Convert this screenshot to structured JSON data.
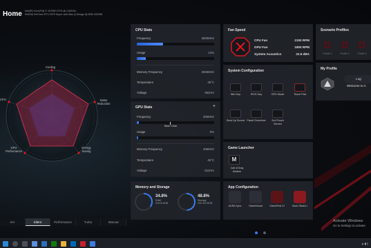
{
  "header": {
    "title": "Home",
    "cpu": "Intel(R) Core(TM) i7-10750H CPU @ 2.60GHz",
    "gpu": "NVIDIA GeForce RTX 2070 Super with Max-Q Design @ 8GB GDDR6"
  },
  "radar": {
    "labels": [
      "Cooling",
      "Noise Reduction",
      "Energy Saving",
      "GPU Performance",
      "CPU Performance"
    ],
    "label_short_cpu": "CPU"
  },
  "modes": [
    "ent",
    "Silent",
    "Performance",
    "Turbo",
    "Manual"
  ],
  "cpu_stats": {
    "title": "CPU Stats",
    "frequency_label": "Frequency",
    "frequency_value": "2500MHz",
    "frequency_pct": 0.34,
    "usage_label": "Usage",
    "usage_value": "12%",
    "usage_pct": 0.12,
    "memfreq_label": "Memory Frequency",
    "memfreq_value": "2926MHz",
    "temp_label": "Temperature",
    "temp_value": "45°C",
    "voltage_label": "Voltage",
    "voltage_value": "662mV"
  },
  "gpu_stats": {
    "title": "GPU Stats",
    "frequency_label": "Frequency",
    "frequency_value": "300MHz",
    "frequency_pct": 0.03,
    "base_clock_label": "Base Clock",
    "usage_label": "Usage",
    "usage_value": "0%",
    "usage_pct": 0.0,
    "memfreq_label": "Memory Frequency",
    "memfreq_value": "405MHz",
    "temp_label": "Temperature",
    "temp_value": "45°C",
    "voltage_label": "Voltage",
    "voltage_value": "612mV"
  },
  "fan_speed": {
    "title": "Fan Speed",
    "cpu_fan_label": "CPU Fan",
    "cpu_fan_value": "2100 RPM",
    "gpu_fan_label": "GPU Fan",
    "gpu_fan_value": "1800 RPM",
    "acoustics_label": "System Acoustics",
    "acoustics_value": "22.6 dBA"
  },
  "scenario_profiles": {
    "title": "Scenario Profiles",
    "profiles": [
      "Profile 1",
      "Profile 2",
      "Profile 3"
    ]
  },
  "my_profile": {
    "title": "My Profile",
    "login_label": "Log",
    "welcome": "Welcome to A"
  },
  "system_config": {
    "title": "System Configuration",
    "items": [
      "Win Key",
      "ROG Key",
      "GPU Mode",
      "Touch Pad",
      "Boot Up Sound",
      "Panel Overdrive",
      "2nd Touch Screen"
    ]
  },
  "game_launcher": {
    "title": "Game Launcher",
    "game": "Call of Duty Modern"
  },
  "memory": {
    "title": "Memory and Storage",
    "ram_pct": "34.8%",
    "ram_pct_value": 0.348,
    "ram_label": "RAM",
    "ram_value": "5.6/15.8GB",
    "storage_pct": "48.8%",
    "storage_pct_value": 0.488,
    "storage_label": "Storage",
    "storage_value": "232.3/476GB"
  },
  "app_config": {
    "title": "App Configuration",
    "apps": [
      "AURA Sync",
      "GameVisual",
      "GameFirst VI",
      "Sonic Studio I"
    ]
  },
  "activate": {
    "title": "Activate Windows",
    "sub": "Go to Settings to activate"
  },
  "colors": {
    "accent_red": "#e1151f",
    "bar_blue": "#3b7af0"
  }
}
